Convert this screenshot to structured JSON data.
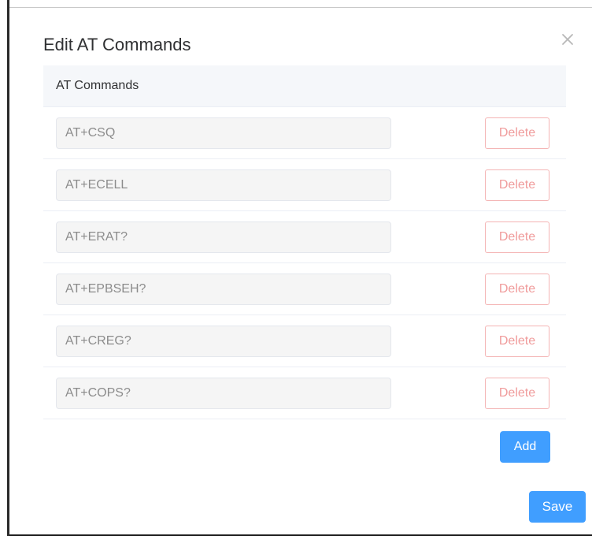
{
  "dialog": {
    "title": "Edit AT Commands",
    "close_icon": "close-icon"
  },
  "table": {
    "header": "AT Commands",
    "rows": [
      {
        "command": "AT+CSQ",
        "delete_label": "Delete"
      },
      {
        "command": "AT+ECELL",
        "delete_label": "Delete"
      },
      {
        "command": "AT+ERAT?",
        "delete_label": "Delete"
      },
      {
        "command": "AT+EPBSEH?",
        "delete_label": "Delete"
      },
      {
        "command": "AT+CREG?",
        "delete_label": "Delete"
      },
      {
        "command": "AT+COPS?",
        "delete_label": "Delete"
      }
    ]
  },
  "actions": {
    "add_label": "Add",
    "save_label": "Save"
  },
  "colors": {
    "primary": "#409eff",
    "danger_border": "#f4b4b4",
    "danger_text": "#f09b9b",
    "header_bg": "#f5f7fa",
    "input_bg": "#f5f5f5"
  }
}
